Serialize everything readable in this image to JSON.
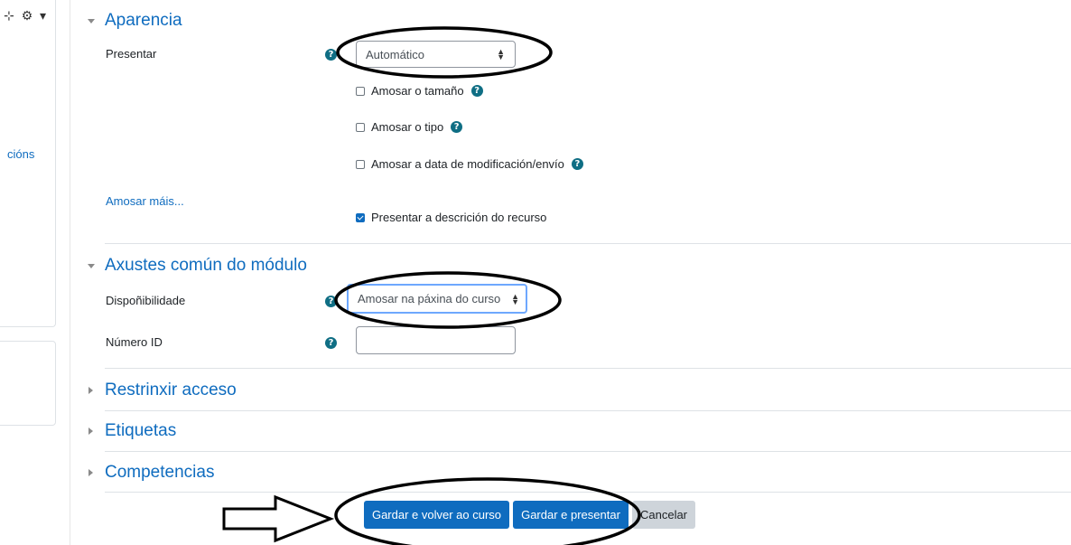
{
  "sidebar": {
    "icons": "⊹ ⚙ ▾",
    "link_fragment": "cións"
  },
  "sections": {
    "appearance": {
      "title": "Aparencia",
      "display_label": "Presentar",
      "display_value": "Automático",
      "checkboxes": [
        {
          "label": "Amosar o tamaño",
          "checked": false,
          "help": true
        },
        {
          "label": "Amosar o tipo",
          "checked": false,
          "help": true
        },
        {
          "label": "Amosar a data de modificación/envío",
          "checked": false,
          "help": true
        },
        {
          "label": "Presentar a descrición do recurso",
          "checked": true,
          "help": false
        }
      ],
      "show_more": "Amosar máis..."
    },
    "common": {
      "title": "Axustes común do módulo",
      "availability_label": "Dispoñibilidade",
      "availability_value": "Amosar na páxina do curso",
      "idnumber_label": "Número ID",
      "idnumber_value": ""
    },
    "collapsed": [
      "Restrinxir acceso",
      "Etiquetas",
      "Competencias"
    ]
  },
  "buttons": {
    "save_return": "Gardar e volver ao curso",
    "save_display": "Gardar e presentar",
    "cancel": "Cancelar"
  },
  "colors": {
    "link": "#0f6cbf",
    "primary_button": "#0f6cbf",
    "secondary_button": "#ced4da",
    "help_icon": "#0f6e84"
  },
  "icons": {
    "help": "question-circle-icon",
    "select_arrows": "sort-icon",
    "section_expanded": "caret-down-icon",
    "section_collapsed": "caret-right-icon"
  }
}
